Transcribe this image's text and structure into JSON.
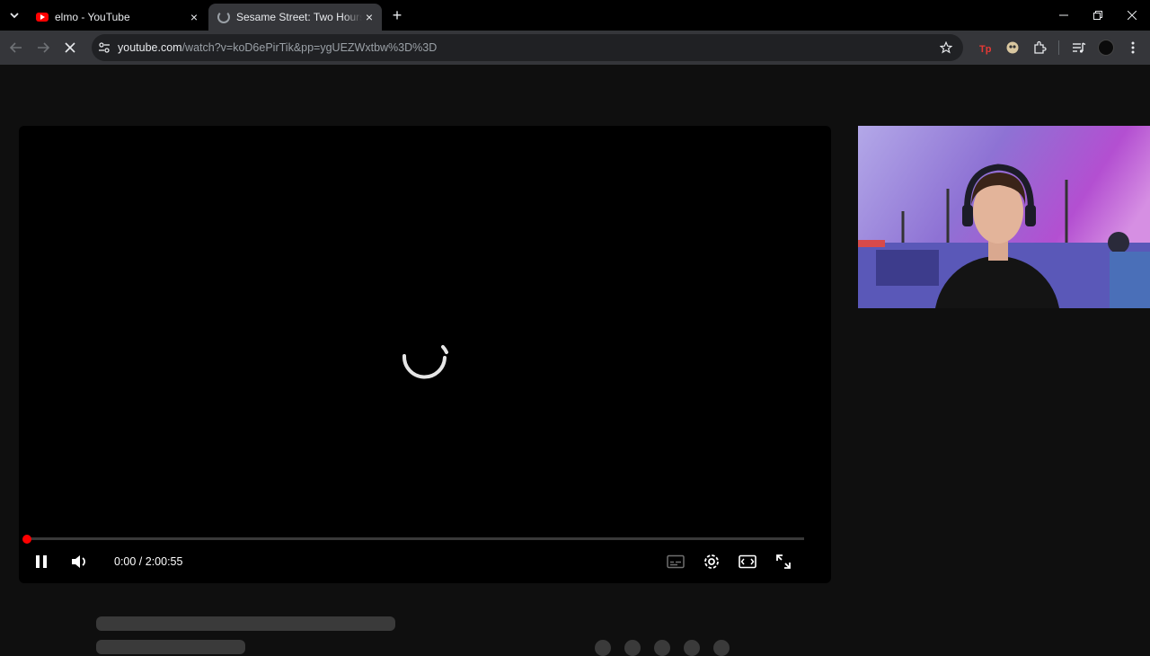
{
  "browser": {
    "tabs": [
      {
        "title": "elmo - YouTube",
        "icon": "youtube-icon",
        "active": false
      },
      {
        "title": "Sesame Street: Two Hours of Elmo",
        "icon": "loading-icon",
        "active": true
      }
    ],
    "url_main": "youtube.com",
    "url_rest": "/watch?v=koD6ePirTik&pp=ygUEZWxtbw%3D%3D",
    "accent": "#35363a"
  },
  "player": {
    "current_time": "0:00",
    "duration": "2:00:55",
    "time_display": "0:00 / 2:00:55",
    "progress": 0,
    "state": "loading",
    "progress_color": "#ff0000"
  }
}
